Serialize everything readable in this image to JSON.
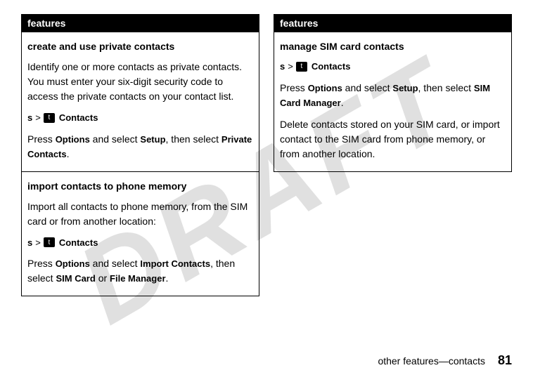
{
  "watermark": "DRAFT",
  "left": {
    "header": "features",
    "sections": [
      {
        "title": "create and use private contacts",
        "body": "Identify one or more contacts as private contacts. You must enter your six-digit security code to access the private contacts on your contact list.",
        "nav_center": "s",
        "nav_sep": ">",
        "nav_chip": "t",
        "nav_label": "Contacts",
        "instr_pre": "Press ",
        "instr_b1": "Options",
        "instr_mid1": " and select ",
        "instr_b2": "Setup",
        "instr_mid2": ", then select ",
        "instr_b3": "Private Contacts",
        "instr_post": "."
      },
      {
        "title": "import contacts to phone memory",
        "body": "Import all contacts to phone memory, from the SIM card or from another location:",
        "nav_center": "s",
        "nav_sep": ">",
        "nav_chip": "t",
        "nav_label": "Contacts",
        "instr_pre": "Press ",
        "instr_b1": "Options",
        "instr_mid1": " and select ",
        "instr_b2": "Import Contacts",
        "instr_mid2": ", then select ",
        "instr_b3": "SIM Card",
        "instr_or": " or ",
        "instr_b4": "File Manager",
        "instr_post": "."
      }
    ]
  },
  "right": {
    "header": "features",
    "sections": [
      {
        "title": "manage SIM card contacts",
        "nav_center": "s",
        "nav_sep": ">",
        "nav_chip": "t",
        "nav_label": "Contacts",
        "instr_pre": "Press ",
        "instr_b1": "Options",
        "instr_mid1": " and select ",
        "instr_b2": "Setup",
        "instr_mid2": ", then select ",
        "instr_b3": "SIM Card Manager",
        "instr_post": ".",
        "body2": "Delete contacts stored on your SIM card, or import contact to the SIM card from phone memory, or from another location."
      }
    ]
  },
  "footer": {
    "section": "other features—contacts",
    "page": "81"
  }
}
